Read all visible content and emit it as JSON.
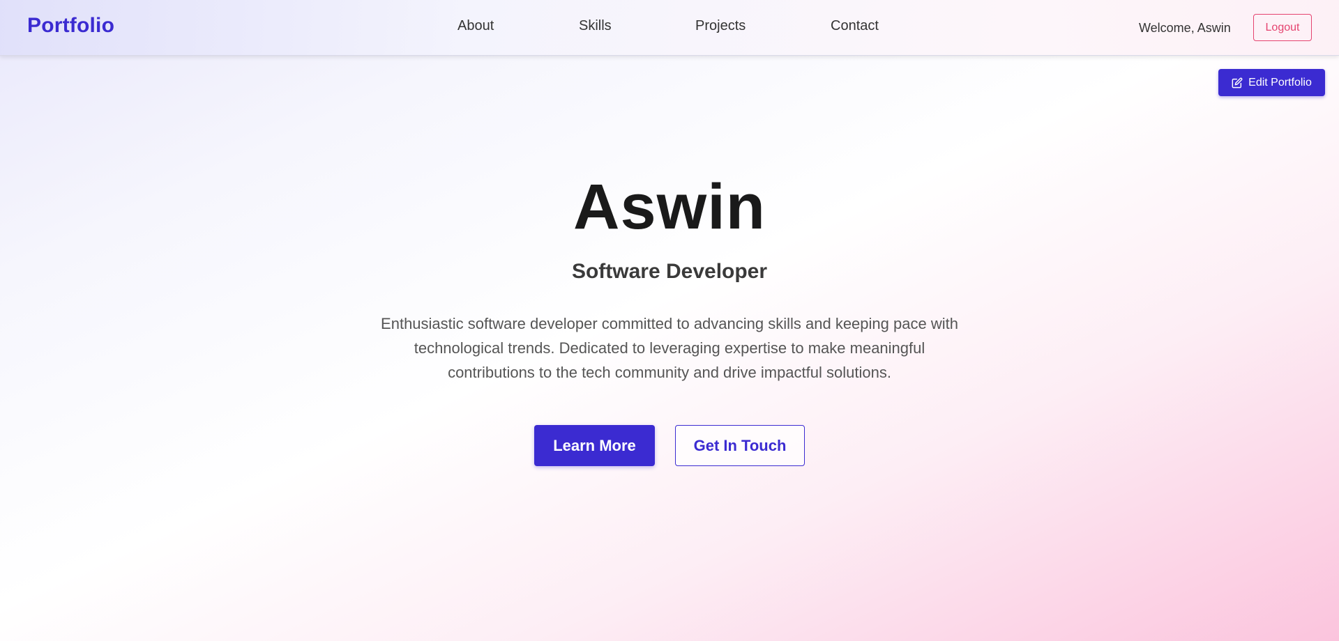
{
  "navbar": {
    "brand": "Portfolio",
    "links": [
      {
        "label": "About"
      },
      {
        "label": "Skills"
      },
      {
        "label": "Projects"
      },
      {
        "label": "Contact"
      }
    ],
    "welcome_text": "Welcome, Aswin",
    "logout_label": "Logout"
  },
  "edit_button": {
    "label": "Edit Portfolio",
    "icon": "edit-icon"
  },
  "hero": {
    "name": "Aswin",
    "title": "Software Developer",
    "description": "Enthusiastic software developer committed to advancing skills and keeping pace with technological trends. Dedicated to leveraging expertise to make meaningful contributions to the tech community and drive impactful solutions.",
    "primary_button": "Learn More",
    "secondary_button": "Get In Touch"
  },
  "colors": {
    "accent": "#3b2bd1",
    "logout": "#e5436f"
  }
}
